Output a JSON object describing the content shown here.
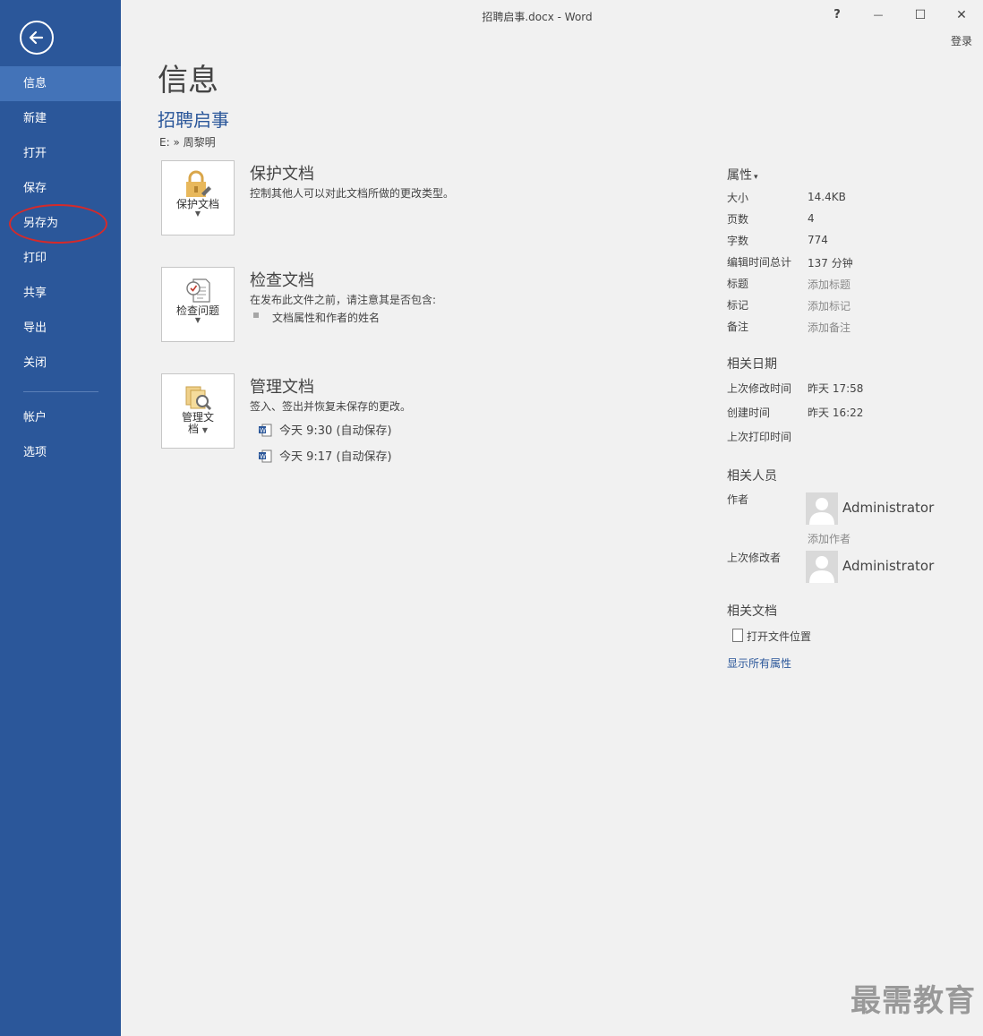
{
  "window": {
    "title": "招聘启事.docx - Word",
    "help": "?",
    "minimize": "—",
    "maximize": "☐",
    "close": "✕",
    "login": "登录"
  },
  "sidebar": {
    "items": [
      {
        "label": "信息"
      },
      {
        "label": "新建"
      },
      {
        "label": "打开"
      },
      {
        "label": "保存"
      },
      {
        "label": "另存为"
      },
      {
        "label": "打印"
      },
      {
        "label": "共享"
      },
      {
        "label": "导出"
      },
      {
        "label": "关闭"
      },
      {
        "label": "帐户"
      },
      {
        "label": "选项"
      }
    ]
  },
  "main": {
    "page_title": "信息",
    "doc_title": "招聘启事",
    "doc_path": "E: » 周黎明",
    "protect": {
      "tile_label": "保护文档",
      "title": "保护文档",
      "desc": "控制其他人可以对此文档所做的更改类型。"
    },
    "inspect": {
      "tile_label": "检查问题",
      "title": "检查文档",
      "desc": "在发布此文件之前，请注意其是否包含:",
      "bullet": "文档属性和作者的姓名"
    },
    "manage": {
      "tile_label_1": "管理文",
      "tile_label_2": "档",
      "title": "管理文档",
      "desc": "签入、签出并恢复未保存的更改。",
      "versions": [
        {
          "label": "今天 9:30 (自动保存)"
        },
        {
          "label": "今天 9:17 (自动保存)"
        }
      ]
    }
  },
  "properties": {
    "header": "属性",
    "header_caret": "▾",
    "rows": [
      {
        "key": "大小",
        "value": "14.4KB"
      },
      {
        "key": "页数",
        "value": "4"
      },
      {
        "key": "字数",
        "value": "774"
      },
      {
        "key": "编辑时间总计",
        "value": "137 分钟"
      },
      {
        "key": "标题",
        "value": "添加标题"
      },
      {
        "key": "标记",
        "value": "添加标记"
      },
      {
        "key": "备注",
        "value": "添加备注"
      }
    ],
    "dates_header": "相关日期",
    "dates": [
      {
        "key": "上次修改时间",
        "value": "昨天 17:58"
      },
      {
        "key": "创建时间",
        "value": "昨天 16:22"
      },
      {
        "key": "上次打印时间",
        "value": ""
      }
    ],
    "people_header": "相关人员",
    "author_label": "作者",
    "author_name": "Administrator",
    "add_author": "添加作者",
    "modifier_label": "上次修改者",
    "modifier_name": "Administrator",
    "docs_header": "相关文档",
    "open_location": "打开文件位置",
    "show_all": "显示所有属性"
  },
  "watermark": "最需教育"
}
